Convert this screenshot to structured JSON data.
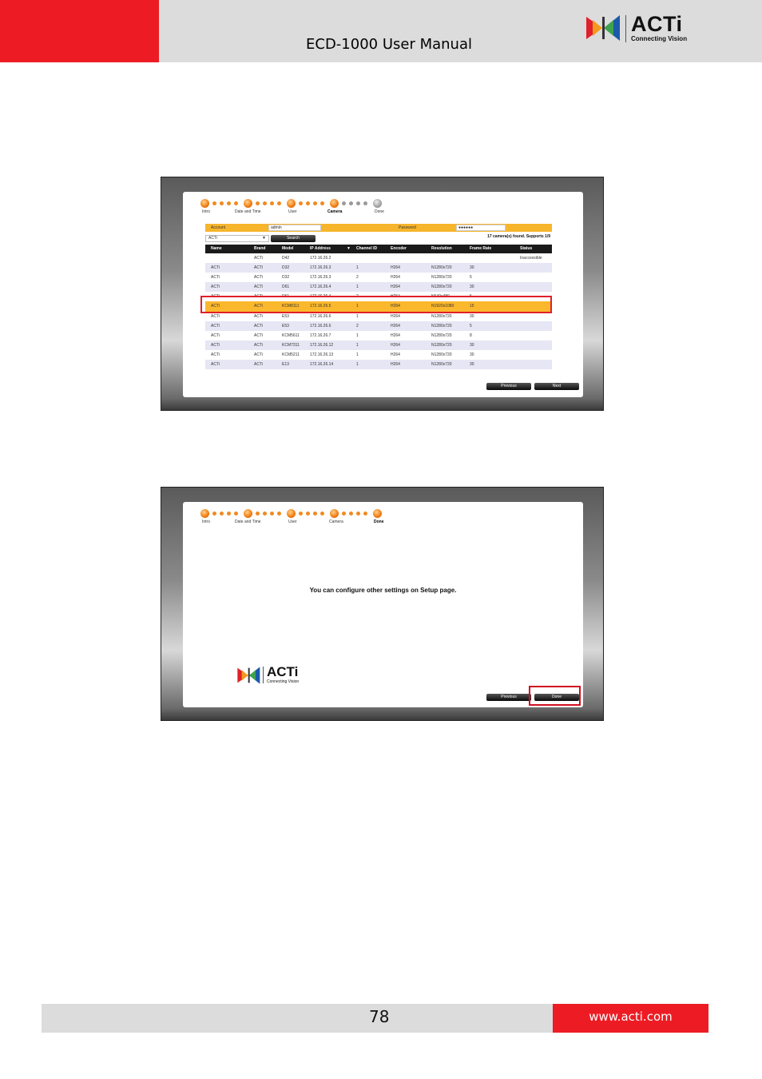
{
  "header": {
    "title": "ECD-1000 User Manual"
  },
  "logo": {
    "brand": "ACTi",
    "tagline": "Connecting Vision"
  },
  "wizard_steps": [
    {
      "label": "Intro"
    },
    {
      "label": "Date and Time"
    },
    {
      "label": "User"
    },
    {
      "label": "Camera"
    },
    {
      "label": "Done"
    }
  ],
  "screen1": {
    "account_label": "Account",
    "account_value": "admin",
    "password_label": "Password",
    "password_value": "●●●●●●",
    "brand_select": "ACTi",
    "search_button": "Search",
    "found_text": "17 camera(s) found.   Supports 1/9",
    "columns": [
      "Name",
      "Brand",
      "Model",
      "IP Address",
      "Channel ID",
      "Encoder",
      "Resolution",
      "Frame Rate",
      "Status"
    ],
    "rows": [
      [
        "",
        "ACTi",
        "D42",
        "172.16.26.2",
        "",
        "",
        "",
        "",
        "Inaccessible"
      ],
      [
        "ACTi",
        "ACTi",
        "D32",
        "172.16.26.3",
        "1",
        "H264",
        "N1280x720",
        "30",
        ""
      ],
      [
        "ACTi",
        "ACTi",
        "D32",
        "172.16.26.3",
        "2",
        "H264",
        "N1280x720",
        "5",
        ""
      ],
      [
        "ACTi",
        "ACTi",
        "D61",
        "172.16.26.4",
        "1",
        "H264",
        "N1280x720",
        "30",
        ""
      ],
      [
        "ACTi",
        "ACTi",
        "D61",
        "172.16.26.4",
        "2",
        "H264",
        "N640x480",
        "5",
        ""
      ],
      [
        "ACTi",
        "ACTi",
        "KCM8111",
        "172.16.26.5",
        "1",
        "H264",
        "N1920x1080",
        "15",
        ""
      ],
      [
        "ACTi",
        "ACTi",
        "E53",
        "172.16.26.6",
        "1",
        "H264",
        "N1280x720",
        "30",
        ""
      ],
      [
        "ACTi",
        "ACTi",
        "E53",
        "172.16.26.6",
        "2",
        "H264",
        "N1280x720",
        "5",
        ""
      ],
      [
        "ACTi",
        "ACTi",
        "KCM5611",
        "172.16.26.7",
        "1",
        "H264",
        "N1280x720",
        "8",
        ""
      ],
      [
        "ACTi",
        "ACTi",
        "KCM7311",
        "172.16.26.12",
        "1",
        "H264",
        "N1280x720",
        "30",
        ""
      ],
      [
        "ACTi",
        "ACTi",
        "KCM5211",
        "172.16.26.13",
        "1",
        "H264",
        "N1280x720",
        "30",
        ""
      ],
      [
        "ACTi",
        "ACTi",
        "E13",
        "172.16.26.14",
        "1",
        "H264",
        "N1280x720",
        "30",
        ""
      ]
    ],
    "previous_button": "Previous",
    "next_button": "Next"
  },
  "screen2": {
    "message": "You can configure other settings on Setup page.",
    "previous_button": "Previous",
    "done_button": "Done"
  },
  "footer": {
    "page_number": "78",
    "website": "www.acti.com"
  },
  "colors": {
    "brand_red": "#ed1c24",
    "header_gray": "#dcdcdc",
    "highlight_yellow": "#fbb82c",
    "highlight_box": "#e0202a"
  }
}
